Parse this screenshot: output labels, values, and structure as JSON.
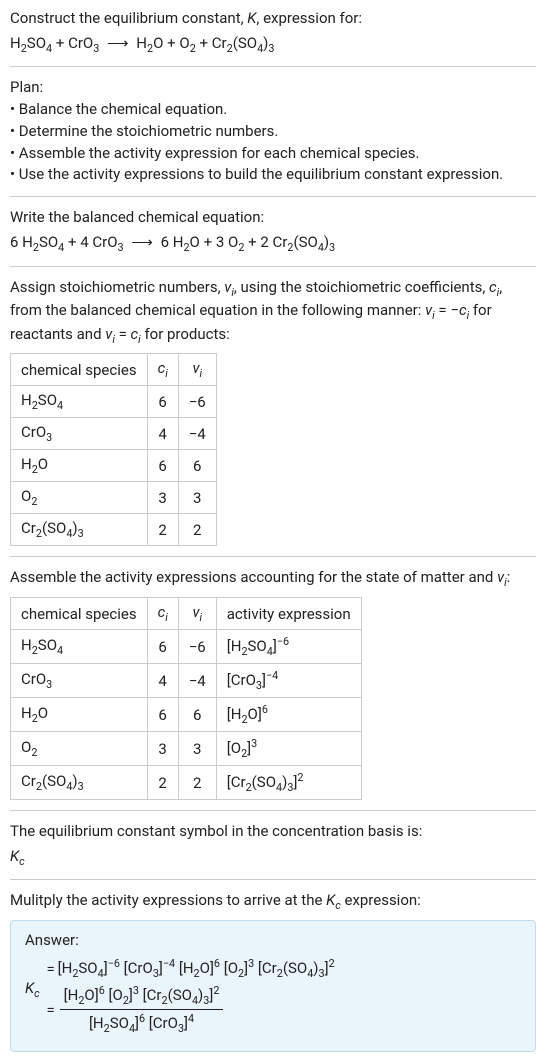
{
  "chart_data": [
    {
      "type": "table",
      "title": "Stoichiometric coefficients and numbers",
      "columns": [
        "chemical species",
        "c_i",
        "ν_i"
      ],
      "rows": [
        [
          "H2SO4",
          6,
          -6
        ],
        [
          "CrO3",
          4,
          -4
        ],
        [
          "H2O",
          6,
          6
        ],
        [
          "O2",
          3,
          3
        ],
        [
          "Cr2(SO4)3",
          2,
          2
        ]
      ]
    },
    {
      "type": "table",
      "title": "Activity expressions",
      "columns": [
        "chemical species",
        "c_i",
        "ν_i",
        "activity expression"
      ],
      "rows": [
        [
          "H2SO4",
          6,
          -6,
          "[H2SO4]^-6"
        ],
        [
          "CrO3",
          4,
          -4,
          "[CrO3]^-4"
        ],
        [
          "H2O",
          6,
          6,
          "[H2O]^6"
        ],
        [
          "O2",
          3,
          3,
          "[O2]^3"
        ],
        [
          "Cr2(SO4)3",
          2,
          2,
          "[Cr2(SO4)3]^2"
        ]
      ]
    }
  ],
  "intro": {
    "line1": "Construct the equilibrium constant, ",
    "K": "K",
    "line1b": ", expression for:",
    "eq_left_h2so4": "H",
    "eq_plus": " + ",
    "eq_arrow": "⟶",
    "sp": {
      "h2so4_a": "H",
      "h2so4_b": "2",
      "h2so4_c": "SO",
      "h2so4_d": "4",
      "cro3_a": "CrO",
      "cro3_b": "3",
      "h2o_a": "H",
      "h2o_b": "2",
      "h2o_c": "O",
      "o2_a": "O",
      "o2_b": "2",
      "cr2so43_a": "Cr",
      "cr2so43_b": "2",
      "cr2so43_c": "(SO",
      "cr2so43_d": "4",
      "cr2so43_e": ")",
      "cr2so43_f": "3"
    }
  },
  "plan": {
    "header": "Plan:",
    "i1": "• Balance the chemical equation.",
    "i2": "• Determine the stoichiometric numbers.",
    "i3": "• Assemble the activity expression for each chemical species.",
    "i4": "• Use the activity expressions to build the equilibrium constant expression."
  },
  "balanced": {
    "header": "Write the balanced chemical equation:",
    "c1": "6 ",
    "c2": "4 ",
    "c3": "6 ",
    "c4": "3 ",
    "c5": "2 ",
    "plus": " + ",
    "arrow": "⟶"
  },
  "stoich": {
    "p1": "Assign stoichiometric numbers, ",
    "vi": "ν",
    "ii": "i",
    "p2": ", using the stoichiometric coefficients, ",
    "ci": "c",
    "p3": ", from the balanced chemical equation in the following manner: ",
    "eq1a": "ν",
    "eq1b": " = −",
    "eq1c": "c",
    "p4": " for reactants and ",
    "eq2a": "ν",
    "eq2b": " = ",
    "eq2c": "c",
    "p5": " for products:"
  },
  "table1": {
    "h1": "chemical species",
    "h2": "c",
    "h2i": "i",
    "h3": "ν",
    "h3i": "i",
    "r": {
      "0c": "6",
      "0v": "−6",
      "1c": "4",
      "1v": "−4",
      "2c": "6",
      "2v": "6",
      "3c": "3",
      "3v": "3",
      "4c": "2",
      "4v": "2"
    }
  },
  "assemble": {
    "p": "Assemble the activity expressions accounting for the state of matter and ",
    "vi": "ν",
    "ii": "i",
    "colon": ":"
  },
  "table2": {
    "h1": "chemical species",
    "h2": "c",
    "h2i": "i",
    "h3": "ν",
    "h3i": "i",
    "h4": "activity expression",
    "r": {
      "0c": "6",
      "0v": "−6",
      "0e": "−6",
      "1c": "4",
      "1v": "−4",
      "1e": "−4",
      "2c": "6",
      "2v": "6",
      "2e": "6",
      "3c": "3",
      "3v": "3",
      "3e": "3",
      "4c": "2",
      "2e2": "2",
      "4v": "2",
      "4e": "2"
    }
  },
  "kcsym": {
    "p": "The equilibrium constant symbol in the concentration basis is:",
    "k": "K",
    "c": "c"
  },
  "mul": {
    "p": "Mulitply the activity expressions to arrive at the ",
    "k": "K",
    "c": "c",
    "p2": " expression:"
  },
  "answer": {
    "label": "Answer:",
    "k": "K",
    "c": "c",
    "eq": " = ",
    "exp": {
      "m6": "−6",
      "m4": "−4",
      "p6": "6",
      "p3": "3",
      "p2": "2",
      "p4": "4"
    }
  }
}
